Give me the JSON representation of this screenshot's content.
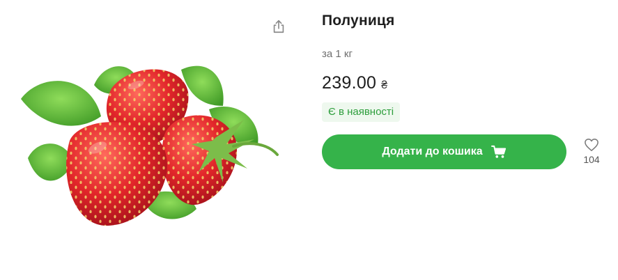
{
  "product": {
    "title": "Полуниця",
    "unit_text": "за 1 кг",
    "price": "239.00",
    "currency": "₴",
    "stock_status": "Є в наявності",
    "image_icon": "strawberry-image"
  },
  "actions": {
    "add_to_cart_label": "Додати до кошика",
    "favorites_count": "104",
    "share_icon": "share-icon",
    "cart_icon": "cart-icon",
    "favorite_icon": "heart-icon"
  },
  "colors": {
    "accent": "#35b34a",
    "stock_bg": "#eef8ee",
    "stock_text": "#2d9e3c"
  }
}
